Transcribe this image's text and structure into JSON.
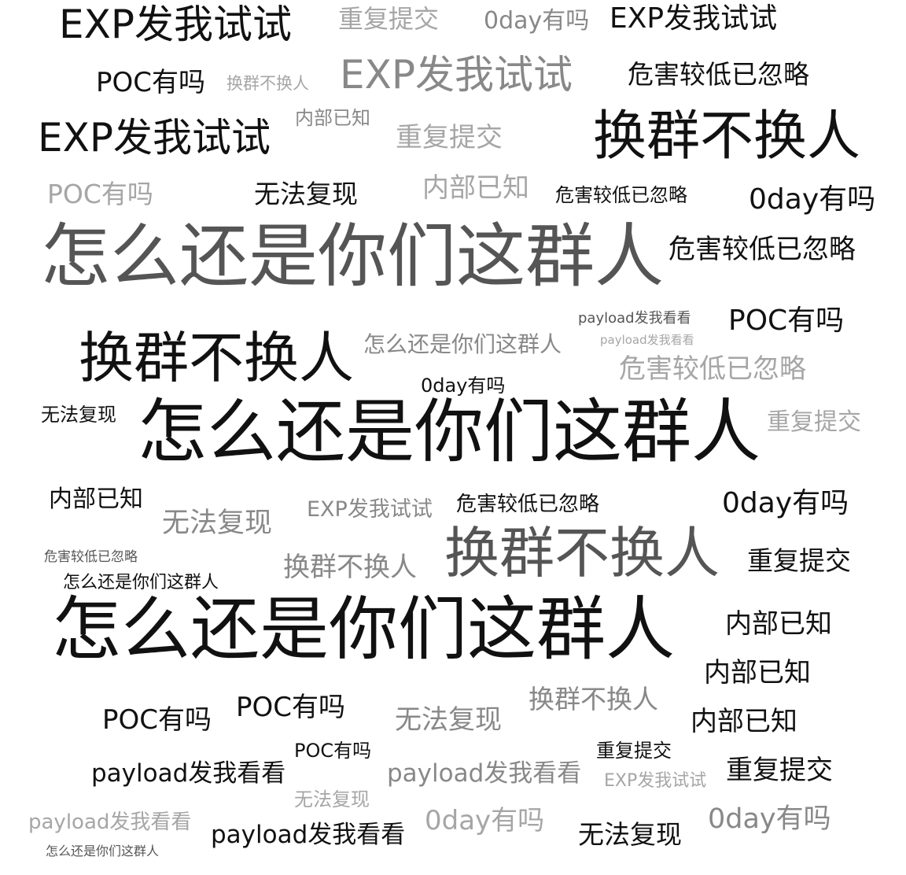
{
  "words": [
    "EXP发我试试",
    "重复提交",
    "0day有吗",
    "EXP发我试试",
    "POC有吗",
    "换群不换人",
    "EXP发我试试",
    "危害较低已忽略",
    "EXP发我试试",
    "内部已知",
    "重复提交",
    "换群不换人",
    "POC有吗",
    "无法复现",
    "内部已知",
    "危害较低已忽略",
    "0day有吗",
    "怎么还是你们这群人",
    "危害较低已忽略",
    "payload发我看看",
    "POC有吗",
    "payload发我看看",
    "换群不换人",
    "怎么还是你们这群人",
    "危害较低已忽略",
    "0day有吗",
    "无法复现",
    "怎么还是你们这群人",
    "重复提交",
    "内部已知",
    "EXP发我试试",
    "危害较低已忽略",
    "0day有吗",
    "无法复现",
    "换群不换人",
    "危害较低已忽略",
    "换群不换人",
    "重复提交",
    "怎么还是你们这群人",
    "怎么还是你们这群人",
    "内部已知",
    "内部已知",
    "POC有吗",
    "POC有吗",
    "换群不换人",
    "无法复现",
    "内部已知",
    "POC有吗",
    "重复提交",
    "payload发我看看",
    "payload发我看看",
    "EXP发我试试",
    "重复提交",
    "无法复现",
    "payload发我看看",
    "0day有吗",
    "payload发我看看",
    "无法复现",
    "0day有吗",
    "怎么还是你们这群人"
  ]
}
